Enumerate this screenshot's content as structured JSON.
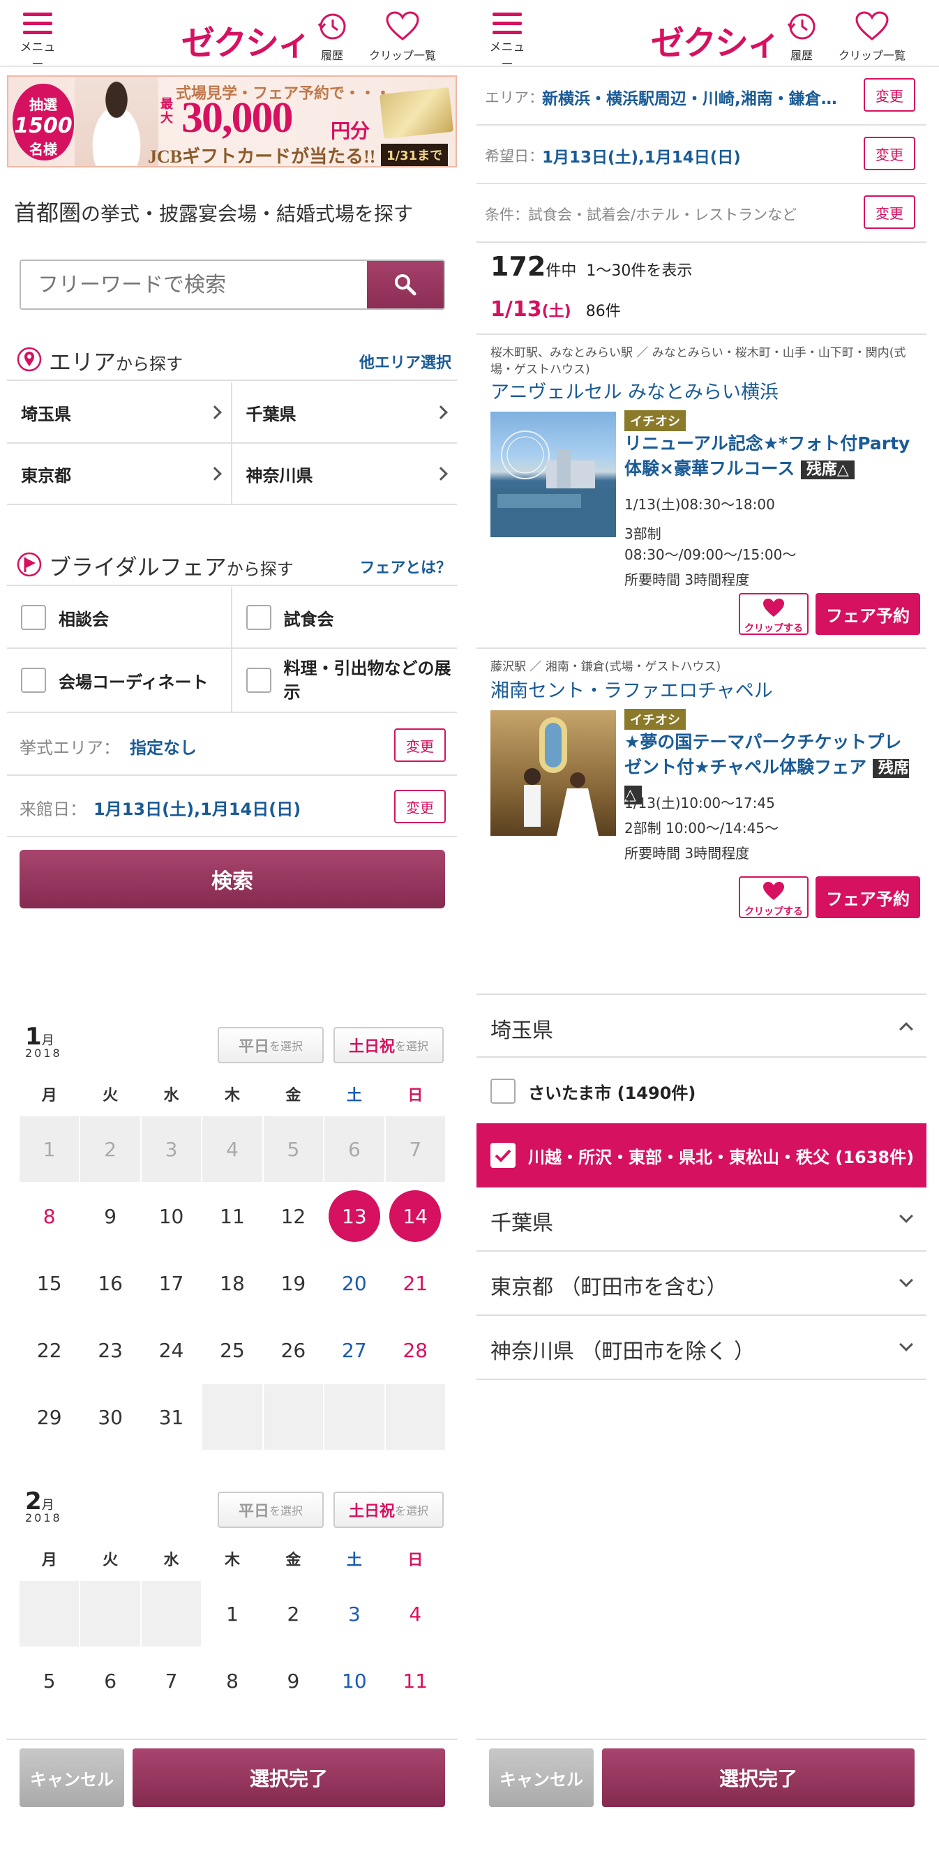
{
  "header": {
    "logo": "ゼクシィ",
    "menu_label": "メニュー",
    "history_label": "履歴",
    "clip_label": "クリップ一覧"
  },
  "banner": {
    "badge_top": "抽選",
    "badge_num": "1500",
    "badge_bottom": "名様",
    "line1": "式場見学・フェア予約で・・・",
    "prefix": "最大",
    "amount": "30,000",
    "unit": "円分",
    "line3": "JCBギフトカードが当たる!!",
    "deadline": "1/31まで"
  },
  "search_page": {
    "title_prefix": "首都圏",
    "title_rest": "の挙式・披露宴会場・結婚式場を探す",
    "search_placeholder": "フリーワードで検索",
    "area_section": {
      "title": "エリア",
      "suffix": "から探す",
      "link": "他エリア選択"
    },
    "prefectures": [
      "埼玉県",
      "千葉県",
      "東京都",
      "神奈川県"
    ],
    "fair_section": {
      "title": "ブライダルフェア",
      "suffix": "から探す",
      "link": "フェアとは？"
    },
    "fair_types": [
      "相談会",
      "試食会",
      "会場コーディネート",
      "料理・引出物などの展示"
    ],
    "area_label": "挙式エリア：",
    "area_value": "指定なし",
    "visit_label": "来館日：",
    "visit_value": "1月13日(土),1月14日(日)",
    "change_label": "変更",
    "search_button": "検索"
  },
  "results_page": {
    "filters": [
      {
        "label": "エリア：",
        "value": "新横浜・横浜駅周辺・川崎,湘南・鎌倉,..."
      },
      {
        "label": "希望日：",
        "value": "1月13日(土),1月14日(日)"
      },
      {
        "label": "条件：",
        "value": "試食会・試着会/ホテル・レストランなど"
      }
    ],
    "change_label": "変更",
    "total": "172",
    "total_suffix": "件中",
    "range": "1〜30件を表示",
    "date": "1/13",
    "date_dow": "(土)",
    "date_count": "86件",
    "venues": [
      {
        "location": "桜木町駅、みなとみらい駅 ／ みなとみらい・桜木町・山手・山下町・関内(式場・ゲストハウス)",
        "name": "アニヴェルセル みなとみらい横浜",
        "tag": "イチオシ",
        "fair_title": "リニューアル記念★*フォト付Party体験×豪華フルコース",
        "badge": "残席△",
        "time": "1/13(土)08:30〜18:00",
        "parts": "3部制 08:30〜/09:00〜/15:00〜",
        "duration": "所要時間 3時間程度",
        "clip_label": "クリップする",
        "reserve_label": "フェア予約"
      },
      {
        "location": "藤沢駅 ／ 湘南・鎌倉(式場・ゲストハウス)",
        "name": "湘南セント・ラファエロチャペル",
        "tag": "イチオシ",
        "fair_title": "★夢の国テーマパークチケットプレゼント付★チャペル体験フェア",
        "badge": "残席△",
        "time": "1/13(土)10:00〜17:45",
        "parts": "2部制 10:00〜/14:45〜",
        "duration": "所要時間 3時間程度",
        "clip_label": "クリップする",
        "reserve_label": "フェア予約"
      }
    ]
  },
  "calendar": {
    "weekday_btn": "平日",
    "weekend_btn": "土日祝",
    "select_suffix": "を選択",
    "weekdays": [
      "月",
      "火",
      "水",
      "木",
      "金",
      "土",
      "日"
    ],
    "months": [
      {
        "month": "1",
        "month_suffix": "月",
        "year": "2018",
        "weeks": [
          [
            "1",
            "2",
            "3",
            "4",
            "5",
            "6",
            "7"
          ],
          [
            "8",
            "9",
            "10",
            "11",
            "12",
            "13",
            "14"
          ],
          [
            "15",
            "16",
            "17",
            "18",
            "19",
            "20",
            "21"
          ],
          [
            "22",
            "23",
            "24",
            "25",
            "26",
            "27",
            "28"
          ],
          [
            "29",
            "30",
            "31",
            "",
            "",
            "",
            ""
          ]
        ],
        "selected": [
          "13",
          "14"
        ]
      },
      {
        "month": "2",
        "month_suffix": "月",
        "year": "2018",
        "weeks": [
          [
            "",
            "",
            "",
            "1",
            "2",
            "3",
            "4"
          ],
          [
            "5",
            "6",
            "7",
            "8",
            "9",
            "10",
            "11"
          ]
        ],
        "selected": []
      }
    ],
    "cancel_label": "キャンセル",
    "done_label": "選択完了"
  },
  "area_picker": {
    "groups": [
      {
        "title": "埼玉県",
        "expanded": true,
        "options": [
          {
            "label": "さいたま市 (1490件)",
            "checked": false
          },
          {
            "label": "川越・所沢・東部・県北・東松山・秩父 (1638件)",
            "checked": true
          }
        ]
      },
      {
        "title": "千葉県",
        "expanded": false
      },
      {
        "title": "東京都 （町田市を含む）",
        "expanded": false
      },
      {
        "title": "神奈川県 （町田市を除く ）",
        "expanded": false
      }
    ],
    "cancel_label": "キャンセル",
    "done_label": "選択完了"
  },
  "colors": {
    "brand": "#d6115f",
    "link": "#1a5b96",
    "button": "#8c2e55"
  }
}
